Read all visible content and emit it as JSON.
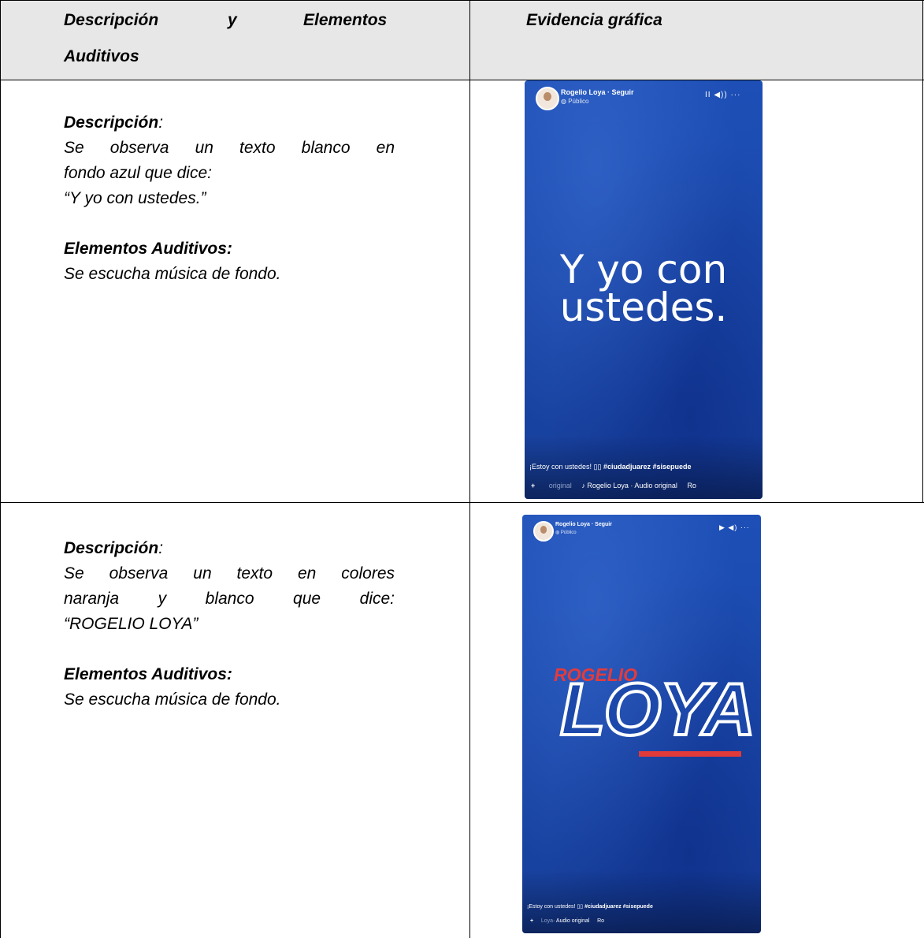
{
  "header": {
    "col1_line1_a": "Descripción",
    "col1_line1_b": "y",
    "col1_line1_c": "Elementos",
    "col1_line2": "Auditivos",
    "col2": "Evidencia gráfica"
  },
  "rows": [
    {
      "description_label": "Descripción",
      "description_colon": ":",
      "description_lines": [
        "Se observa un texto blanco en",
        "fondo azul que dice:",
        "“Y yo con ustedes.”"
      ],
      "audio_label": "Elementos Auditivos:",
      "audio_text": "Se escucha música de fondo.",
      "phone": {
        "name": "Rogelio Loya · Seguir",
        "privacy": "Público",
        "controls": "II ◀)) ···",
        "main_text_line1": "Y yo con",
        "main_text_line2": "ustedes.",
        "caption_prefix": "¡Estoy con ustedes! ",
        "caption_emoji": "▯▯",
        "caption_hashtags": " #ciudadjuarez #sisepuede",
        "audio_plus": "+",
        "audio_dim": "original",
        "audio_text": "Rogelio Loya · Audio original",
        "audio_tail": "Ro"
      }
    },
    {
      "description_label": "Descripción",
      "description_colon": ":",
      "description_lines": [
        "Se observa un texto en colores",
        "naranja y blanco que dice:",
        "“ROGELIO LOYA”"
      ],
      "audio_label": "Elementos Auditivos:",
      "audio_text": "Se escucha música de fondo.",
      "phone": {
        "name": "Rogelio Loya · Seguir",
        "privacy": "Público",
        "controls": "▶ ◀) ···",
        "logo_small": "ROGELIO",
        "logo_big": "LOYA",
        "caption_prefix": "¡Estoy con ustedes! ",
        "caption_emoji": "▯▯",
        "caption_hashtags": " #ciudadjuarez #sisepuede",
        "audio_plus": "+",
        "audio_dim": "Loya",
        "audio_text": "· Audio original",
        "audio_tail": "Ro"
      }
    }
  ],
  "colors": {
    "header_bg": "#e7e7e7",
    "phone_blue": "#1b48aa",
    "logo_red": "#e03a3a"
  }
}
